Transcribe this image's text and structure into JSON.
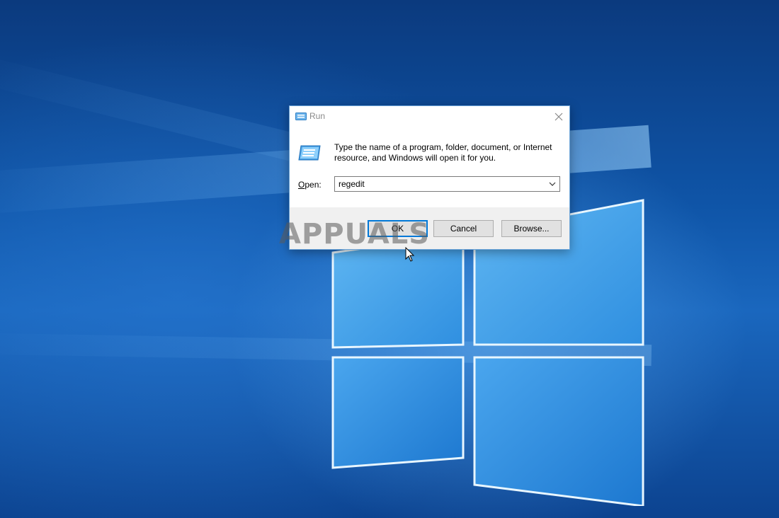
{
  "window": {
    "title": "Run",
    "close_icon": "close-icon",
    "app_icon": "run-icon"
  },
  "dialog": {
    "description": "Type the name of a program, folder, document, or Internet resource, and Windows will open it for you.",
    "open_label_prefix": "O",
    "open_label_rest": "pen:",
    "open_value": "regedit",
    "buttons": {
      "ok": "OK",
      "cancel": "Cancel",
      "browse": "Browse..."
    }
  },
  "watermark": {
    "text": "APPUALS"
  },
  "colors": {
    "accent": "#0078d7",
    "desktop_blue": "#0f55a8",
    "footer_gray": "#f0f0f0"
  }
}
